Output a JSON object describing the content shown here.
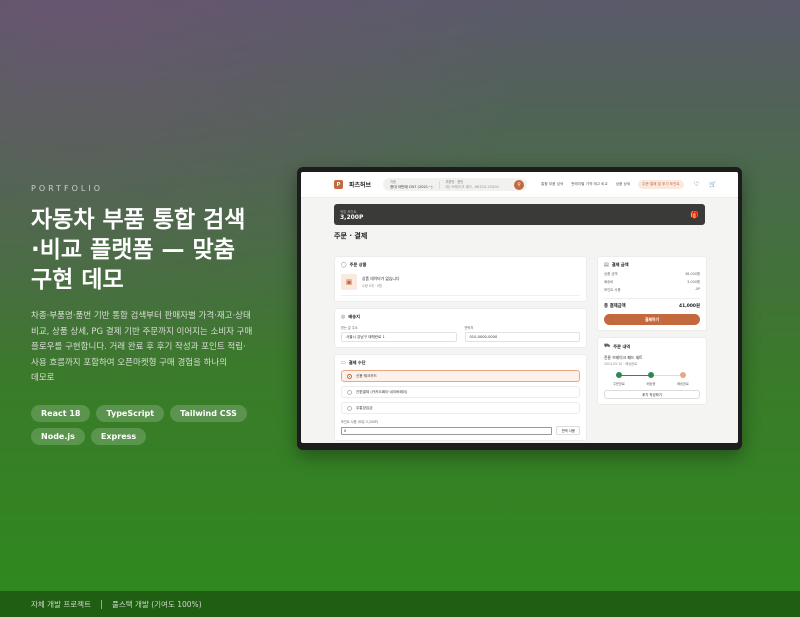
{
  "hero": {
    "eyebrow": "PORTFOLIO",
    "title_line1": "자동차 부품 통합 검색",
    "title_line2": "·비교 플랫폼 — 맞춤",
    "title_line3": "구현 데모",
    "desc_line1": "차종·부품명·품번 기반 통합 검색부터 판매자별 가격·재고·상태",
    "desc_line2": "비교, 상품 상세, PG 결제 기반 주문까지 이어지는 소비자 구매",
    "desc_line3": "플로우를 구현합니다. 거래 완료 후 후기 작성과 포인트 적립·",
    "desc_line4": "사용 흐름까지 포함하여 오픈마켓형 구매 경험을 하나의",
    "desc_line5": "데모로",
    "tags": [
      "React 18",
      "TypeScript",
      "Tailwind CSS",
      "Node.js",
      "Express"
    ]
  },
  "footer": {
    "left": "자체 개발 프로젝트",
    "right": "풀스택 개발 (기여도 100%)"
  },
  "app": {
    "logo_mark": "P",
    "logo_text": "파츠허브",
    "search": {
      "vehicle_label": "차종",
      "vehicle_value": "현대 아반떼 CN7 (2021~)",
      "part_label": "부품명 · 품번",
      "part_value": "예) 브레이크 패드, 86320-2S000"
    },
    "menu": [
      "통합 부품 검색",
      "판매자별 가격·재고 비교",
      "상품 상세",
      "주문·결제 및 후기 포인트"
    ],
    "points": {
      "label": "적립 포인트",
      "value": "3,200P"
    },
    "page_title": "주문 · 결제",
    "order_item": {
      "title": "주문 상품",
      "name": "상품 데이터가 없습니다",
      "sub": "수량 0개 · 0원"
    },
    "shipping": {
      "title": "배송지",
      "addr_label": "받는 분 주소",
      "addr_value": "서울시 강남구 테헤란로 1",
      "phone_label": "연락처",
      "phone_value": "010-0000-0000"
    },
    "payment": {
      "title": "결제 수단",
      "options": [
        "신용·체크카드",
        "간편결제 (카카오페이·네이버페이)",
        "무통장입금"
      ],
      "points_label": "포인트 사용 (보유 3,200P)",
      "points_value": "0",
      "use_all": "전액 사용"
    },
    "summary": {
      "title": "결제 금액",
      "rows": [
        {
          "label": "상품 금액",
          "value": "38,000원"
        },
        {
          "label": "배송비",
          "value": "3,000원"
        },
        {
          "label": "포인트 사용",
          "value": "-0P"
        }
      ],
      "total_label": "총 결제금액",
      "total_value": "41,000원",
      "pay_button": "결제하기"
    },
    "history": {
      "title": "주문 내역",
      "name": "전륜 브레이크 패드 세트",
      "date": "2024.05.10 · 배송완료",
      "steps": [
        "주문완료",
        "배송중",
        "배송완료"
      ],
      "review_button": "후기 작성하기"
    }
  }
}
